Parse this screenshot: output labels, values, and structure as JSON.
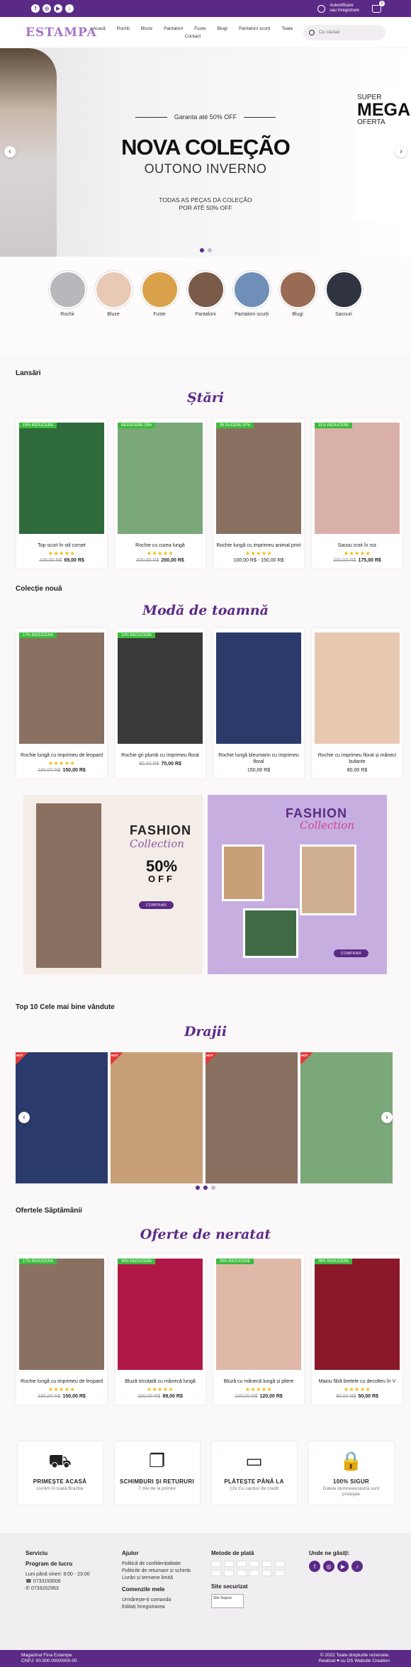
{
  "topbar": {
    "social": [
      "f",
      "◎",
      "▶",
      "♪"
    ],
    "account_line1": "Autentificare",
    "account_line2": "sau înregistrare",
    "cart_count": "0"
  },
  "header": {
    "logo": "ESTAMPA",
    "nav": [
      "Acasă",
      "Rochii",
      "Bluze",
      "Pantaloni",
      "Fuste",
      "Blugi",
      "Pantaloni scurți",
      "Toate",
      "Contact"
    ],
    "search_placeholder": "Ce căutați"
  },
  "hero": {
    "guarantee": "Garanta até 50% OFF",
    "title": "NOVA COLEÇÃO",
    "subtitle": "OUTONO INVERNO",
    "desc_line1": "TODAS AS PEÇAS DA COLEÇÃO",
    "desc_line2": "POR ATÉ 50% OFF",
    "right_small": "SUPER",
    "right_big": "MEGA",
    "right_oferta": "OFERTA"
  },
  "categories": [
    {
      "label": "Rochii",
      "color": "#b8b8bc"
    },
    {
      "label": "Bluze",
      "color": "#e8c9b4"
    },
    {
      "label": "Fuste",
      "color": "#d9a24a"
    },
    {
      "label": "Pantaloni",
      "color": "#7a5a48"
    },
    {
      "label": "Pantaloni scurți",
      "color": "#6f8fb8"
    },
    {
      "label": "Blugi",
      "color": "#9a6b54"
    },
    {
      "label": "Sacouri",
      "color": "#2f3440"
    }
  ],
  "launches": {
    "section_title": "Lansări",
    "script_title": "Ștări",
    "products": [
      {
        "badge": "19% REDUCERE",
        "name": "Top scurt în stil corset",
        "old": "100,00 R$",
        "new": "69,00 R$",
        "color": "#2f6a3a"
      },
      {
        "badge": "REDUCERE 33%",
        "name": "Rochie cu curea lungă",
        "old": "300,00 R$",
        "new": "200,00 R$",
        "color": "#7aa878"
      },
      {
        "badge": "38 DUCERE 97%",
        "name": "Rochie lungă cu imprimeu animal print",
        "old": "",
        "new": "100,00 R$ - 150,00 R$",
        "color": "#8a7060"
      },
      {
        "badge": "31% REDUCERE",
        "name": "Sacou croit în roz",
        "old": "250,00 R$",
        "new": "175,00 R$",
        "color": "#d8b0a8"
      }
    ]
  },
  "collection": {
    "section_title": "Colecție nouă",
    "script_title": "Modă de toamnă",
    "products": [
      {
        "badge": "17% REDUCERE",
        "name": "Rochie lungă cu imprimeu de leopard",
        "old": "180,00 R$",
        "new": "150,00 R$",
        "color": "#8a7060"
      },
      {
        "badge": "13% REDUCERE",
        "name": "Rochie gri plumb cu imprimeu floral",
        "old": "80,00 R$",
        "new": "70,00 R$",
        "color": "#3a3a3a"
      },
      {
        "badge": "",
        "name": "Rochie lungă bleumarin cu imprimeu floral",
        "old": "",
        "new": "150,00 R$",
        "color": "#2a3a6a"
      },
      {
        "badge": "",
        "name": "Rochie cu imprimeu floral și mâneci bufante",
        "old": "",
        "new": "80,00 R$",
        "color": "#e8c8b0"
      }
    ]
  },
  "promos": {
    "left": {
      "fashion": "FASHION",
      "collection": "Collection",
      "off_pct": "50%",
      "off_word": "OFF",
      "button": "COMPRAR"
    },
    "right": {
      "fashion": "FASHION",
      "collection": "Collection",
      "button": "COMPRAR"
    }
  },
  "bestsellers": {
    "section_title": "Top 10 Cele mai bine vândute",
    "script_title": "Drajii",
    "hot_label": "HOT",
    "slides": [
      "#2a3a6a",
      "#c8a078",
      "#8a7060",
      "#7aa878"
    ]
  },
  "offers": {
    "section_title": "Ofertele Săptămânii",
    "script_title": "Oferte de neratat",
    "products": [
      {
        "badge": "17% REDUCERE",
        "name": "Rochie lungă cu imprimeu de leopard",
        "old": "180,00 R$",
        "new": "150,00 R$",
        "color": "#8a7060"
      },
      {
        "badge": "40% REDUCERE",
        "name": "Bluză tricotată cu mânecă lungă",
        "old": "150,00 R$",
        "new": "89,00 R$",
        "color": "#b01848"
      },
      {
        "badge": "20% REDUCERE",
        "name": "Bluză cu mânecă lungă și pliere",
        "old": "150,00 R$",
        "new": "120,00 R$",
        "color": "#e0b8a8"
      },
      {
        "badge": "38% REDUCERE",
        "name": "Maiou fără bretele cu decolteu în V",
        "old": "80,00 R$",
        "new": "50,00 R$",
        "color": "#8a1828"
      }
    ]
  },
  "features": [
    {
      "icon": "⛟",
      "title": "PRIMEȘTE ACASĂ",
      "desc": "Livrăm în toată Brazilia"
    },
    {
      "icon": "❐",
      "title": "SCHIMBURI ȘI RETURURI",
      "desc": "7 zile de la primire"
    },
    {
      "icon": "▭",
      "title": "PLĂTEȘTE PÂNĂ LA",
      "desc": "12x Cu carduri de credit"
    },
    {
      "icon": "🔒",
      "title": "100% SIGUR",
      "desc": "Datele dumneavoastră sunt protejate"
    }
  ],
  "footer": {
    "service_title": "Serviciu",
    "program_title": "Program de lucru",
    "program_hours": "Luni până vineri: 8:00 - 23:00",
    "phone1": "0733193006",
    "phone2": "0733202963",
    "help_title": "Ajutor",
    "help_links": [
      "Politică de confidențialitate",
      "Politicile de returnare și schimb",
      "Livrări și termene limită"
    ],
    "orders_title": "Comenzile mele",
    "orders_links": [
      "Urmărește-ți comanda",
      "Editați înregistrarea"
    ],
    "payment_title": "Metode de plată",
    "secure_title": "Site securizat",
    "secure_badge": "Site Seguro",
    "find_title": "Unde ne găsiți:"
  },
  "bottom": {
    "left_line1": "Magazinul Fina Estampe",
    "left_line2": "CNPJ: 00.000.000/0000-00",
    "right_line1": "© 2022 Toate drepturile rezervate.",
    "right_line2": "Realizat ♥ cu DS Website Creation"
  }
}
